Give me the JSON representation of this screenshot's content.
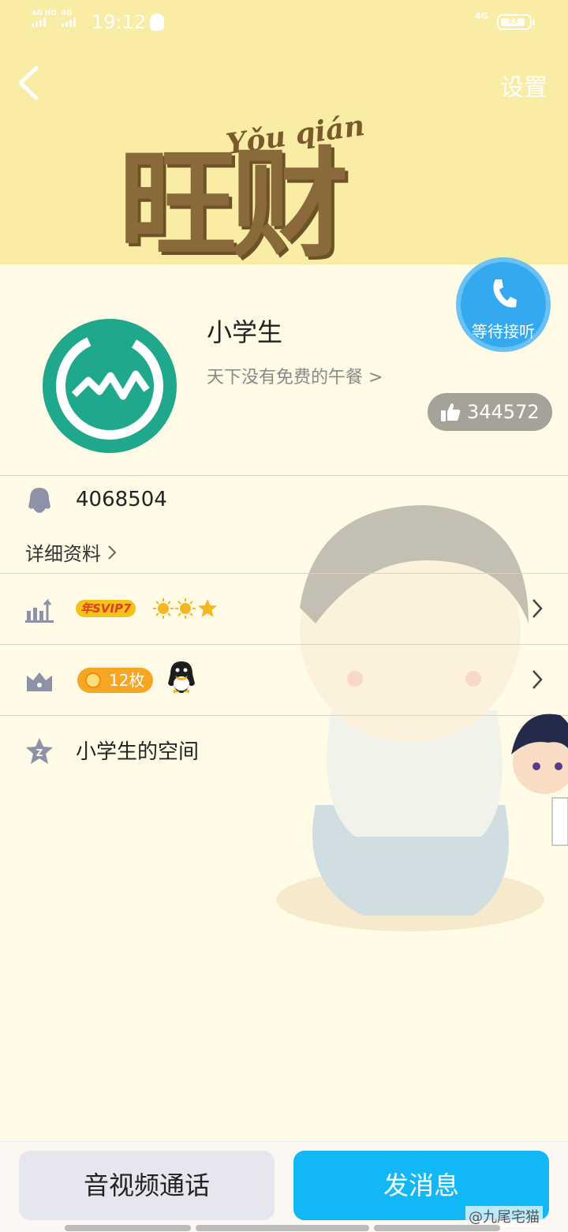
{
  "status_bar": {
    "sim1": "4G HD",
    "sim2": "4G",
    "time": "19:12",
    "network": "4G",
    "battery": "33"
  },
  "header": {
    "settings_label": "设置",
    "deco_title": "旺财",
    "deco_pinyin": "Yǒu qián"
  },
  "call": {
    "label": "等待接听"
  },
  "profile": {
    "nickname": "小学生",
    "signature": "天下没有免费的午餐 >",
    "likes": "344572"
  },
  "rows": {
    "qq_number": "4068504",
    "details_link": "详细资料",
    "svip_badge": "年SVIP7",
    "coins": "12枚",
    "zone": "小学生的空间"
  },
  "bottom": {
    "av_call": "音视频通话",
    "send_message": "发消息",
    "watermark": "@九尾宅猫"
  },
  "colors": {
    "banner": "#f9eca5",
    "accent_blue": "#12b7f5",
    "call_blue": "#35a9f0",
    "badge_gold": "#f4c21b"
  }
}
